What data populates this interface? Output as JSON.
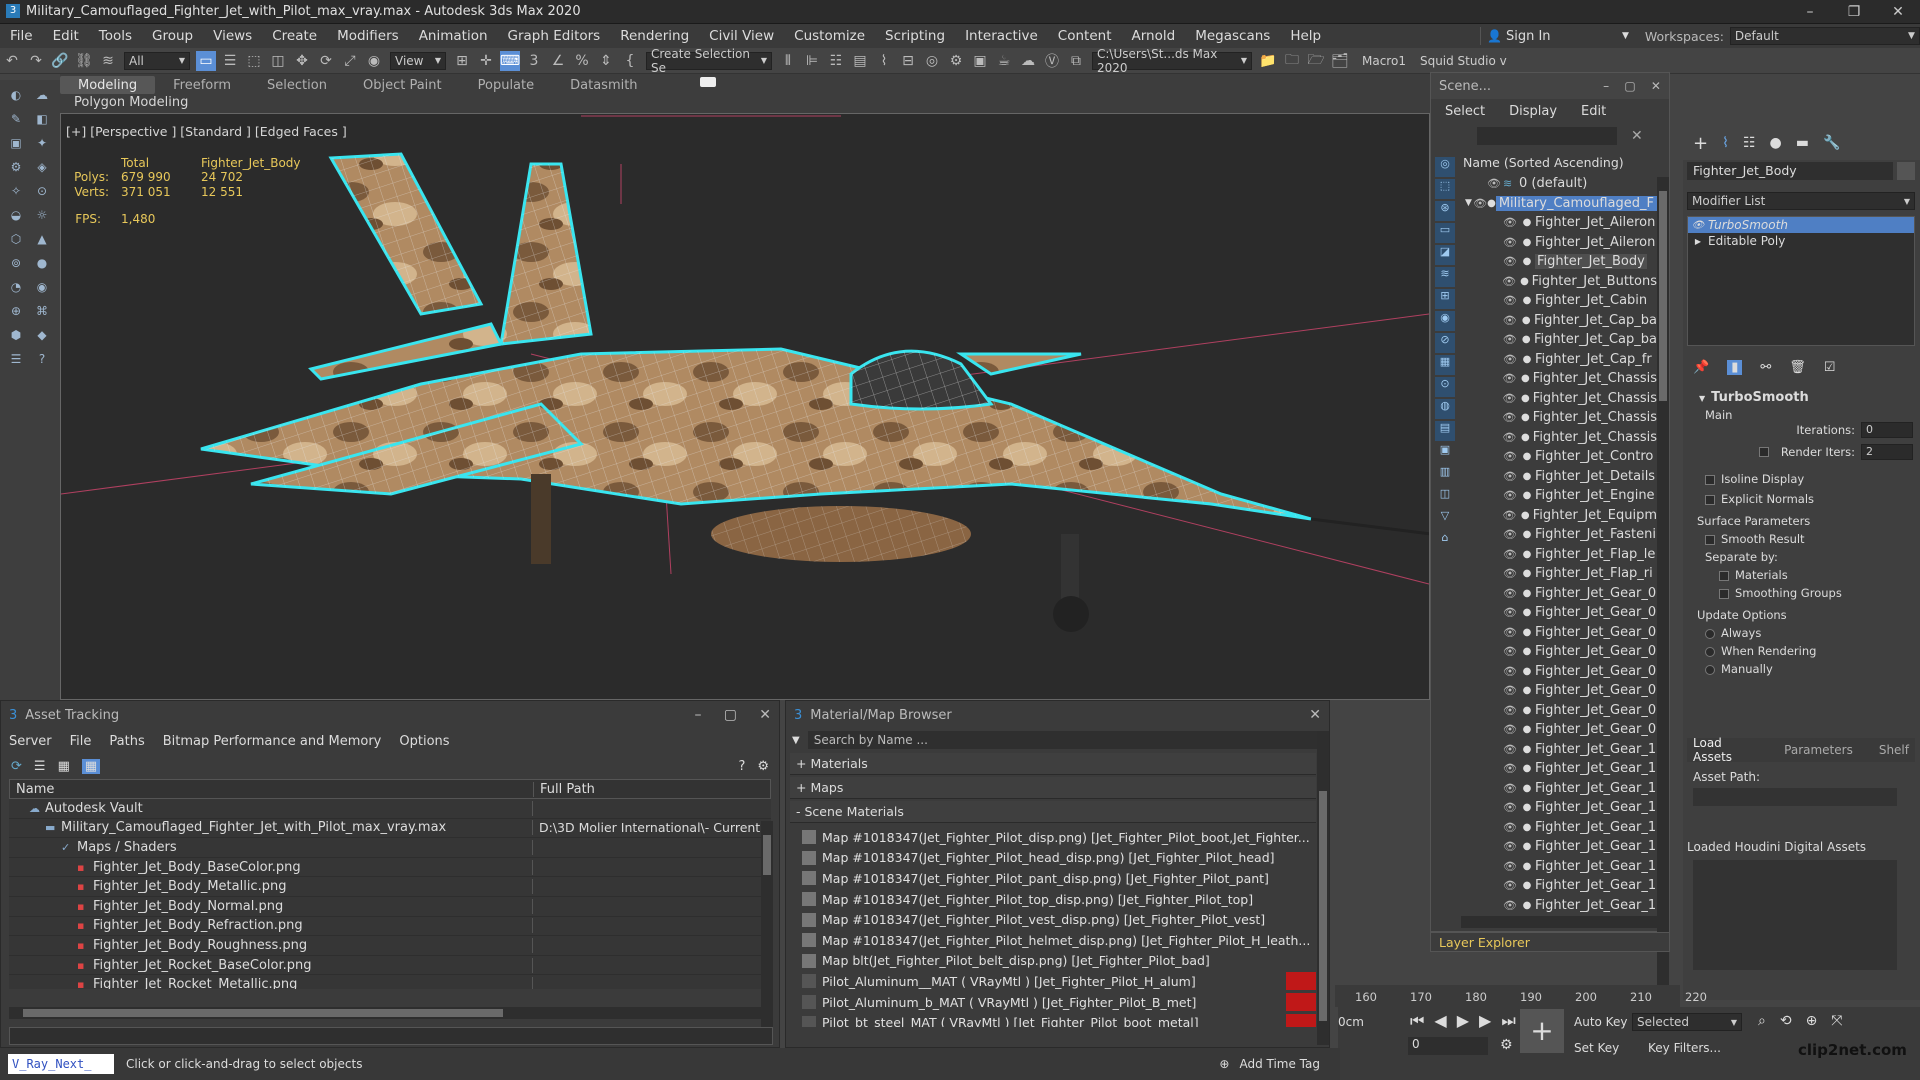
{
  "window": {
    "title": "Military_Camouflaged_Fighter_Jet_with_Pilot_max_vray.max - Autodesk 3ds Max 2020",
    "minimize": "–",
    "maximize": "❐",
    "close": "✕"
  },
  "menu": [
    "File",
    "Edit",
    "Tools",
    "Group",
    "Views",
    "Create",
    "Modifiers",
    "Animation",
    "Graph Editors",
    "Rendering",
    "Civil View",
    "Customize",
    "Scripting",
    "Interactive",
    "Content",
    "Arnold",
    "Megascans",
    "Help"
  ],
  "signin": "Sign In",
  "workspaces_label": "Workspaces:",
  "workspaces_value": "Default",
  "toolbar": {
    "filter": "All",
    "view": "View",
    "selection_set": "Create Selection Se",
    "path": "C:\\Users\\St...ds Max 2020",
    "macro": "Macro1",
    "squid": "Squid Studio v"
  },
  "ribbon": {
    "tabs": [
      "Modeling",
      "Freeform",
      "Selection",
      "Object Paint",
      "Populate",
      "Datasmith"
    ],
    "subtitle": "Polygon Modeling"
  },
  "viewport": {
    "label": "[+] [Perspective ] [Standard ] [Edged Faces ]",
    "stats": {
      "total": "Total",
      "object": "Fighter_Jet_Body",
      "polys_label": "Polys:",
      "polys_total": "679 990",
      "polys_obj": "24 702",
      "verts_label": "Verts:",
      "verts_total": "371 051",
      "verts_obj": "12 551",
      "fps_label": "FPS:",
      "fps": "1,480"
    }
  },
  "scene": {
    "title": "Scene...",
    "menu": [
      "Select",
      "Display",
      "Edit"
    ],
    "column": "Name (Sorted Ascending)",
    "layer_default": "0 (default)",
    "root": "Military_Camouflaged_F",
    "items": [
      "Fighter_Jet_Aileron",
      "Fighter_Jet_Aileron",
      "Fighter_Jet_Body",
      "Fighter_Jet_Buttons",
      "Fighter_Jet_Cabin",
      "Fighter_Jet_Cap_ba",
      "Fighter_Jet_Cap_ba",
      "Fighter_Jet_Cap_fr",
      "Fighter_Jet_Chassis",
      "Fighter_Jet_Chassis",
      "Fighter_Jet_Chassis",
      "Fighter_Jet_Chassis",
      "Fighter_Jet_Contro",
      "Fighter_Jet_Details",
      "Fighter_Jet_Engine",
      "Fighter_Jet_Equipm",
      "Fighter_Jet_Fasteni",
      "Fighter_Jet_Flap_le",
      "Fighter_Jet_Flap_ri",
      "Fighter_Jet_Gear_0",
      "Fighter_Jet_Gear_0",
      "Fighter_Jet_Gear_0",
      "Fighter_Jet_Gear_0",
      "Fighter_Jet_Gear_0",
      "Fighter_Jet_Gear_0",
      "Fighter_Jet_Gear_0",
      "Fighter_Jet_Gear_0",
      "Fighter_Jet_Gear_1",
      "Fighter_Jet_Gear_1",
      "Fighter_Jet_Gear_1",
      "Fighter_Jet_Gear_1",
      "Fighter_Jet_Gear_1",
      "Fighter_Jet_Gear_1",
      "Fighter_Jet_Gear_1",
      "Fighter_Jet_Gear_1",
      "Fighter_Jet_Gear_1"
    ],
    "selected_index": 2,
    "footer": "Layer Explorer"
  },
  "command_panel": {
    "object_name": "Fighter_Jet_Body",
    "modifier_list": "Modifier List",
    "stack": [
      "TurboSmooth",
      "Editable Poly"
    ],
    "rollout": "TurboSmooth",
    "main": "Main",
    "iterations_label": "Iterations:",
    "iterations": "0",
    "render_iters_label": "Render Iters:",
    "render_iters": "2",
    "isoline": "Isoline Display",
    "explicit": "Explicit Normals",
    "surface": "Surface Parameters",
    "smooth_result": "Smooth Result",
    "separate": "Separate by:",
    "materials": "Materials",
    "smoothing_groups": "Smoothing Groups",
    "update": "Update Options",
    "always": "Always",
    "when_rendering": "When Rendering",
    "manually": "Manually",
    "tabs": [
      "Load Assets",
      "Parameters",
      "Shelf"
    ],
    "asset_path": "Asset Path:",
    "loaded_houdini": "Loaded Houdini Digital Assets"
  },
  "asset_tracking": {
    "title": "Asset Tracking",
    "menu": [
      "Server",
      "File",
      "Paths",
      "Bitmap Performance and Memory",
      "Options"
    ],
    "col_name": "Name",
    "col_path": "Full Path",
    "rows": [
      {
        "name": "Autodesk Vault",
        "path": "",
        "indent": 1
      },
      {
        "name": "Military_Camouflaged_Fighter_Jet_with_Pilot_max_vray.max",
        "path": "D:\\3D Molier International\\- Current",
        "indent": 2
      },
      {
        "name": "Maps / Shaders",
        "path": "",
        "indent": 3
      },
      {
        "name": "Fighter_Jet_Body_BaseColor.png",
        "path": "",
        "indent": 4
      },
      {
        "name": "Fighter_Jet_Body_Metallic.png",
        "path": "",
        "indent": 4
      },
      {
        "name": "Fighter_Jet_Body_Normal.png",
        "path": "",
        "indent": 4
      },
      {
        "name": "Fighter_Jet_Body_Refraction.png",
        "path": "",
        "indent": 4
      },
      {
        "name": "Fighter_Jet_Body_Roughness.png",
        "path": "",
        "indent": 4
      },
      {
        "name": "Fighter_Jet_Rocket_BaseColor.png",
        "path": "",
        "indent": 4
      },
      {
        "name": "Fighter_Jet_Rocket_Metallic.png",
        "path": "",
        "indent": 4
      }
    ]
  },
  "material_browser": {
    "title": "Material/Map Browser",
    "search_placeholder": "Search by Name ...",
    "sections": [
      "+ Materials",
      "+ Maps",
      "- Scene Materials"
    ],
    "items": [
      "Map #1018347(Jet_Fighter_Pilot_disp.png) [Jet_Fighter_Pilot_boot,Jet_Fighter...",
      "Map #1018347(Jet_Fighter_Pilot_head_disp.png) [Jet_Fighter_Pilot_head]",
      "Map #1018347(Jet_Fighter_Pilot_pant_disp.png) [Jet_Fighter_Pilot_pant]",
      "Map #1018347(Jet_Fighter_Pilot_top_disp.png) [Jet_Fighter_Pilot_top]",
      "Map #1018347(Jet_Fighter_Pilot_vest_disp.png) [Jet_Fighter_Pilot_vest]",
      "Map #1018347(Jet_Fighter_Pilot_helmet_disp.png) [Jet_Fighter_Pilot_H_leath...",
      "Map blt(Jet_Fighter_Pilot_belt_disp.png) [Jet_Fighter_Pilot_bad]",
      "Pilot_Aluminum__MAT ( VRayMtl ) [Jet_Fighter_Pilot_H_alum]",
      "Pilot_Aluminum_b_MAT ( VRayMtl ) [Jet_Fighter_Pilot_B_met]",
      "Pilot_bt_steel_MAT ( VRayMtl ) [Jet_Fighter_Pilot_boot_metal]"
    ]
  },
  "timeline": {
    "ticks": [
      "160",
      "170",
      "180",
      "190",
      "200",
      "210",
      "220"
    ],
    "unit": "0cm",
    "auto_key": "Auto Key",
    "selected": "Selected",
    "set_key": "Set Key",
    "key_filters": "Key Filters...",
    "frame": "0"
  },
  "status": {
    "script": "V_Ray_Next_",
    "prompt": "Click or click-and-drag to select objects",
    "add_time_tag": "Add Time Tag"
  },
  "watermark": "clip2net.com",
  "colors": {
    "accent": "#5b8fd6",
    "selected": "#4f7fc4",
    "stats": "#e8c85a",
    "wire": "#39e5ef"
  }
}
